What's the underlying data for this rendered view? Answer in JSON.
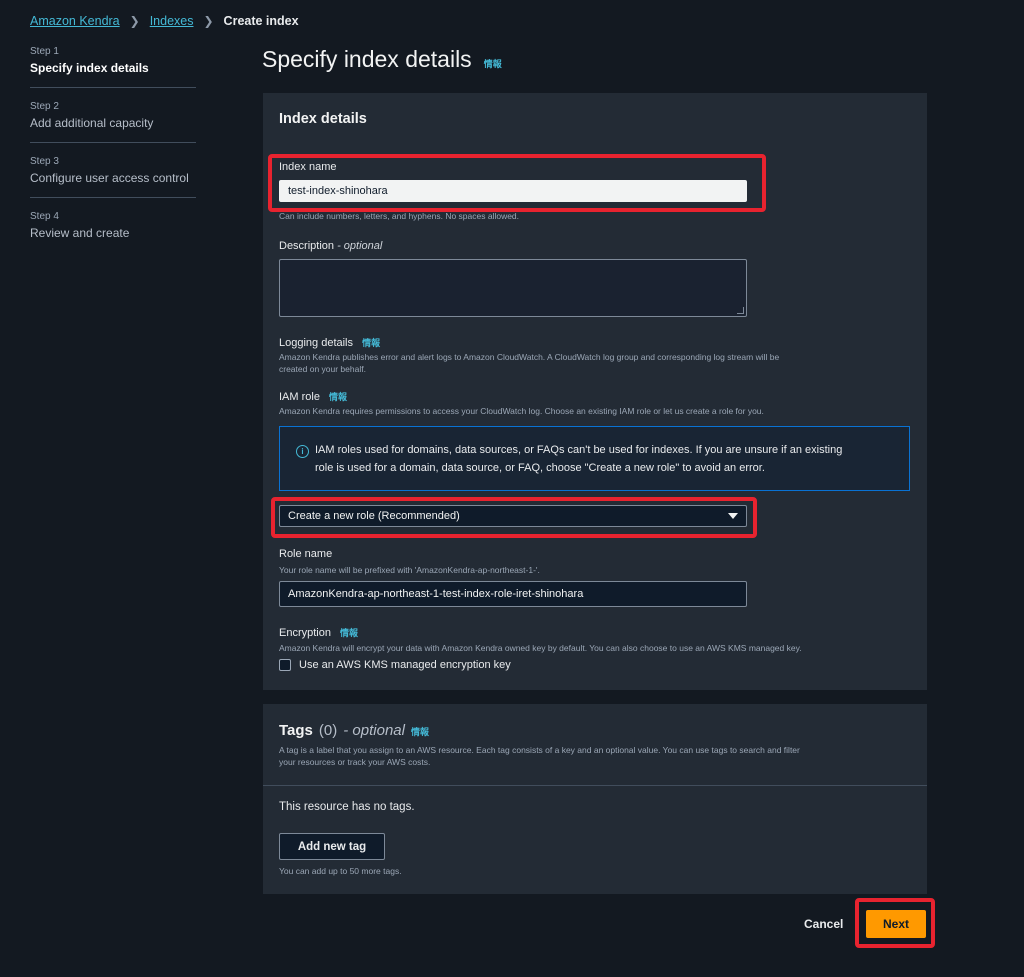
{
  "breadcrumb": {
    "items": [
      "Amazon Kendra",
      "Indexes"
    ],
    "current": "Create index"
  },
  "steps": [
    {
      "num": "Step 1",
      "title": "Specify index details",
      "active": true
    },
    {
      "num": "Step 2",
      "title": "Add additional capacity"
    },
    {
      "num": "Step 3",
      "title": "Configure user access control"
    },
    {
      "num": "Step 4",
      "title": "Review and create"
    }
  ],
  "page": {
    "title": "Specify index details",
    "info": "情報"
  },
  "details": {
    "header": "Index details",
    "index_name": {
      "label": "Index name",
      "value": "test-index-shinohara",
      "hint": "Can include numbers, letters, and hyphens. No spaces allowed."
    },
    "description": {
      "label": "Description",
      "optional": " - optional"
    },
    "logging": {
      "label": "Logging details",
      "info": "情報",
      "desc_line1": "Amazon Kendra publishes error and alert logs to Amazon CloudWatch. A CloudWatch log group and corresponding log stream will be",
      "desc_line2": "created on your behalf."
    },
    "iam": {
      "label": "IAM role",
      "info": "情報",
      "desc": "Amazon Kendra requires permissions to access your CloudWatch log. Choose an existing IAM role or let us create a role for you."
    },
    "alert": {
      "line1": "IAM roles used for domains, data sources, or FAQs can't be used for indexes. If you are unsure if an existing",
      "line2": "role is used for a domain, data source, or FAQ, choose \"Create a new role\" to avoid an error."
    },
    "role_select": {
      "value": "Create a new role (Recommended)"
    },
    "role_name": {
      "label": "Role name",
      "hint": "Your role name will be prefixed with 'AmazonKendra-ap-northeast-1-'.",
      "value": "AmazonKendra-ap-northeast-1-test-index-role-iret-shinohara"
    },
    "encryption": {
      "label": "Encryption",
      "info": "情報",
      "desc": "Amazon Kendra will encrypt your data with Amazon Kendra owned key by default. You can also choose to use an AWS KMS managed key.",
      "checkbox_label": "Use an AWS KMS managed encryption key"
    }
  },
  "tags": {
    "title": "Tags",
    "count": "(0)",
    "optional": "- optional",
    "info": "情報",
    "desc_line1": "A tag is a label that you assign to an AWS resource. Each tag consists of a key and an optional value. You can use tags to search and filter",
    "desc_line2": "your resources or track your AWS costs.",
    "empty": "This resource has no tags.",
    "add_button": "Add new tag",
    "limit_hint": "You can add up to 50 more tags."
  },
  "footer": {
    "cancel": "Cancel",
    "next": "Next"
  },
  "colors": {
    "background": "#131921",
    "panel": "#232b35",
    "link": "#44b9d6",
    "primary": "#ff9900",
    "highlight": "#e8232f"
  },
  "icons": {
    "breadcrumb_separator": "chevron-right-icon",
    "alert": "info-circle-icon",
    "select": "caret-down-icon"
  }
}
